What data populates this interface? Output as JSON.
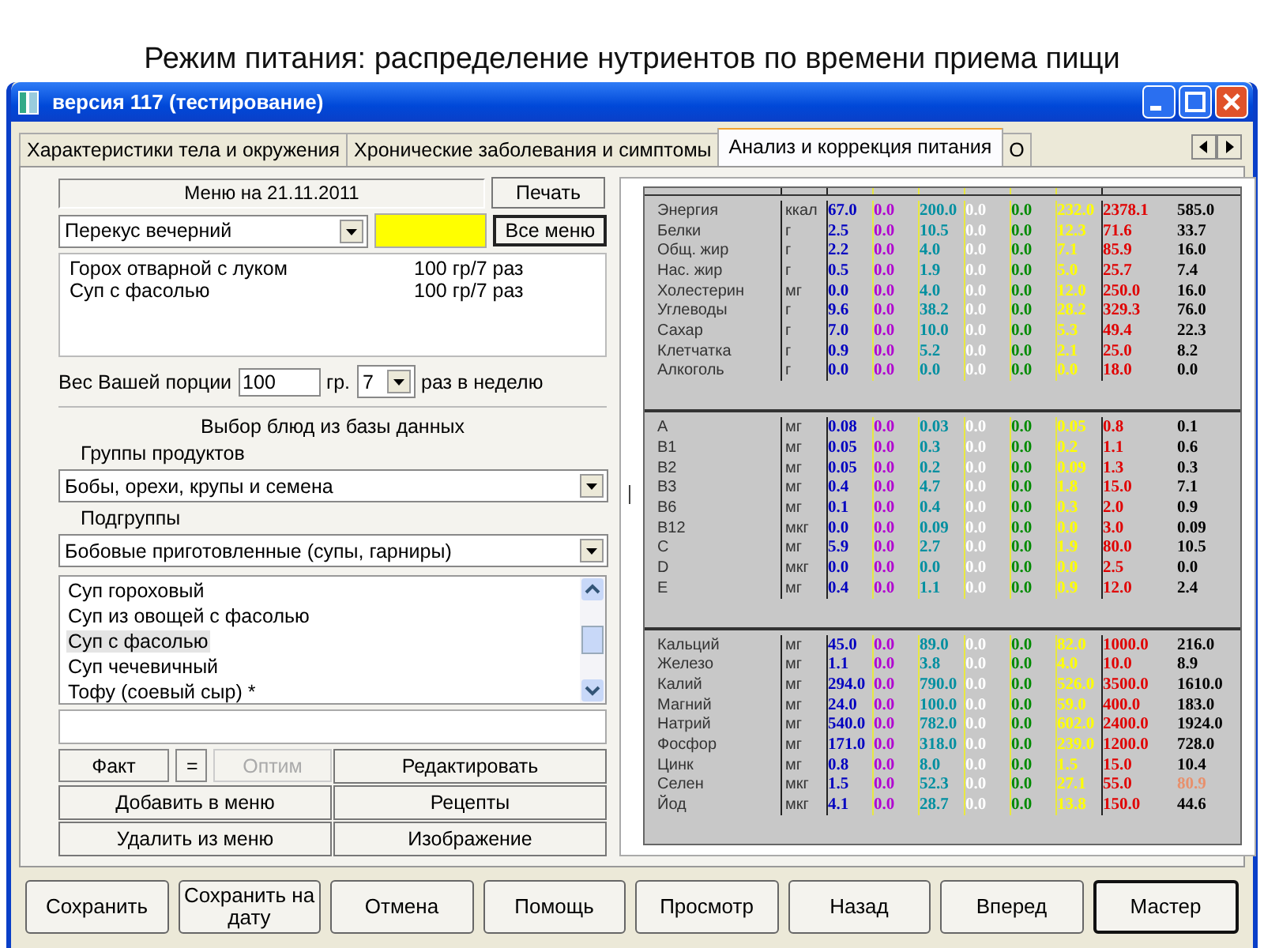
{
  "heading": "Режим питания: распределение нутриентов по времени приема пищи",
  "window": {
    "title": "версия 117 (тестирование)"
  },
  "tabs": [
    {
      "label": "Характеристики тела и окружения",
      "selected": false
    },
    {
      "label": "Хронические заболевания и симптомы",
      "selected": false
    },
    {
      "label": "Анализ и коррекция питания",
      "selected": true
    },
    {
      "label": "О",
      "selected": false
    }
  ],
  "menu": {
    "title": "Меню на 21.11.2011",
    "print_button": "Печать",
    "meal": "Перекус вечерний",
    "all_menu_button": "Все меню",
    "items": [
      {
        "name": "Горох отварной с луком",
        "portion": "100 гр/7 раз"
      },
      {
        "name": "Суп с фасолью",
        "portion": "100 гр/7 раз"
      }
    ]
  },
  "portion": {
    "label": "Вес Вашей порции",
    "value": "100",
    "unit": "гр.",
    "times": "7",
    "suffix": "раз в неделю"
  },
  "database": {
    "title": "Выбор блюд из базы данных",
    "groups_label": "Группы продуктов",
    "group": "Бобы, орехи, крупы и семена",
    "subgroups_label": "Подгруппы",
    "subgroup": "Бобовые приготовленные (супы, гарниры)",
    "dishes": [
      {
        "name": "Суп гороховый",
        "selected": false
      },
      {
        "name": "Суп из овощей с фасолью",
        "selected": false
      },
      {
        "name": "Суп с фасолью",
        "selected": true
      },
      {
        "name": "Суп чечевичный",
        "selected": false
      },
      {
        "name": "Тофу (соевый сыр) *",
        "selected": false
      }
    ]
  },
  "mode_buttons": [
    {
      "label": "Факт",
      "disabled": false
    },
    {
      "label": "=",
      "disabled": false
    },
    {
      "label": "Оптим",
      "disabled": true
    }
  ],
  "action_buttons": [
    "Редактировать",
    "Добавить в меню",
    "Рецепты",
    "Удалить из меню",
    "Изображение"
  ],
  "nutrients": {
    "columns": [
      {
        "color": "#0000c0"
      },
      {
        "color": "#b000d0"
      },
      {
        "color": "#008fa0"
      },
      {
        "color": "#ffffff"
      },
      {
        "color": "#008a00"
      },
      {
        "color": "#ffff00"
      },
      {
        "color": "#e00000"
      },
      {
        "color": "#000000"
      }
    ],
    "sections": [
      {
        "rows": [
          {
            "name": "Энергия",
            "unit": "ккал",
            "flagged": false,
            "values": [
              "67.0",
              "0.0",
              "200.0",
              "0.0",
              "0.0",
              "232.0",
              "2378.1",
              "585.0"
            ]
          },
          {
            "name": "Белки",
            "unit": "г",
            "flagged": false,
            "values": [
              "2.5",
              "0.0",
              "10.5",
              "0.0",
              "0.0",
              "12.3",
              "71.6",
              "33.7"
            ]
          },
          {
            "name": "Общ. жир",
            "unit": "г",
            "flagged": false,
            "values": [
              "2.2",
              "0.0",
              "4.0",
              "0.0",
              "0.0",
              "7.1",
              "85.9",
              "16.0"
            ]
          },
          {
            "name": "Нас. жир",
            "unit": "г",
            "flagged": false,
            "values": [
              "0.5",
              "0.0",
              "1.9",
              "0.0",
              "0.0",
              "5.0",
              "25.7",
              "7.4"
            ]
          },
          {
            "name": "Холестерин",
            "unit": "мг",
            "flagged": false,
            "values": [
              "0.0",
              "0.0",
              "4.0",
              "0.0",
              "0.0",
              "12.0",
              "250.0",
              "16.0"
            ]
          },
          {
            "name": "Углеводы",
            "unit": "г",
            "flagged": false,
            "values": [
              "9.6",
              "0.0",
              "38.2",
              "0.0",
              "0.0",
              "28.2",
              "329.3",
              "76.0"
            ]
          },
          {
            "name": "Сахар",
            "unit": "г",
            "flagged": false,
            "values": [
              "7.0",
              "0.0",
              "10.0",
              "0.0",
              "0.0",
              "5.3",
              "49.4",
              "22.3"
            ]
          },
          {
            "name": "Клетчатка",
            "unit": "г",
            "flagged": false,
            "values": [
              "0.9",
              "0.0",
              "5.2",
              "0.0",
              "0.0",
              "2.1",
              "25.0",
              "8.2"
            ]
          },
          {
            "name": "Алкоголь",
            "unit": "г",
            "flagged": false,
            "values": [
              "0.0",
              "0.0",
              "0.0",
              "0.0",
              "0.0",
              "0.0",
              "18.0",
              "0.0"
            ]
          }
        ]
      },
      {
        "rows": [
          {
            "name": "A",
            "unit": "мг",
            "flagged": false,
            "values": [
              "0.08",
              "0.0",
              "0.03",
              "0.0",
              "0.0",
              "0.05",
              "0.8",
              "0.1"
            ]
          },
          {
            "name": "B1",
            "unit": "мг",
            "flagged": false,
            "values": [
              "0.05",
              "0.0",
              "0.3",
              "0.0",
              "0.0",
              "0.2",
              "1.1",
              "0.6"
            ]
          },
          {
            "name": "B2",
            "unit": "мг",
            "flagged": false,
            "values": [
              "0.05",
              "0.0",
              "0.2",
              "0.0",
              "0.0",
              "0.09",
              "1.3",
              "0.3"
            ]
          },
          {
            "name": "B3",
            "unit": "мг",
            "flagged": false,
            "values": [
              "0.4",
              "0.0",
              "4.7",
              "0.0",
              "0.0",
              "1.8",
              "15.0",
              "7.1"
            ]
          },
          {
            "name": "B6",
            "unit": "мг",
            "flagged": false,
            "values": [
              "0.1",
              "0.0",
              "0.4",
              "0.0",
              "0.0",
              "0.3",
              "2.0",
              "0.9"
            ]
          },
          {
            "name": "B12",
            "unit": "мкг",
            "flagged": false,
            "values": [
              "0.0",
              "0.0",
              "0.09",
              "0.0",
              "0.0",
              "0.0",
              "3.0",
              "0.09"
            ]
          },
          {
            "name": "C",
            "unit": "мг",
            "flagged": false,
            "values": [
              "5.9",
              "0.0",
              "2.7",
              "0.0",
              "0.0",
              "1.9",
              "80.0",
              "10.5"
            ]
          },
          {
            "name": "D",
            "unit": "мкг",
            "flagged": false,
            "values": [
              "0.0",
              "0.0",
              "0.0",
              "0.0",
              "0.0",
              "0.0",
              "2.5",
              "0.0"
            ]
          },
          {
            "name": "E",
            "unit": "мг",
            "flagged": false,
            "values": [
              "0.4",
              "0.0",
              "1.1",
              "0.0",
              "0.0",
              "0.9",
              "12.0",
              "2.4"
            ]
          }
        ]
      },
      {
        "rows": [
          {
            "name": "Кальций",
            "unit": "мг",
            "flagged": false,
            "values": [
              "45.0",
              "0.0",
              "89.0",
              "0.0",
              "0.0",
              "82.0",
              "1000.0",
              "216.0"
            ]
          },
          {
            "name": "Железо",
            "unit": "мг",
            "flagged": false,
            "values": [
              "1.1",
              "0.0",
              "3.8",
              "0.0",
              "0.0",
              "4.0",
              "10.0",
              "8.9"
            ]
          },
          {
            "name": "Калий",
            "unit": "мг",
            "flagged": false,
            "values": [
              "294.0",
              "0.0",
              "790.0",
              "0.0",
              "0.0",
              "526.0",
              "3500.0",
              "1610.0"
            ]
          },
          {
            "name": "Магний",
            "unit": "мг",
            "flagged": false,
            "values": [
              "24.0",
              "0.0",
              "100.0",
              "0.0",
              "0.0",
              "59.0",
              "400.0",
              "183.0"
            ]
          },
          {
            "name": "Натрий",
            "unit": "мг",
            "flagged": false,
            "values": [
              "540.0",
              "0.0",
              "782.0",
              "0.0",
              "0.0",
              "602.0",
              "2400.0",
              "1924.0"
            ]
          },
          {
            "name": "Фосфор",
            "unit": "мг",
            "flagged": false,
            "values": [
              "171.0",
              "0.0",
              "318.0",
              "0.0",
              "0.0",
              "239.0",
              "1200.0",
              "728.0"
            ]
          },
          {
            "name": "Цинк",
            "unit": "мг",
            "flagged": false,
            "values": [
              "0.8",
              "0.0",
              "8.0",
              "0.0",
              "0.0",
              "1.5",
              "15.0",
              "10.4"
            ]
          },
          {
            "name": "Селен",
            "unit": "мкг",
            "flagged": true,
            "values": [
              "1.5",
              "0.0",
              "52.3",
              "0.0",
              "0.0",
              "27.1",
              "55.0",
              "80.9"
            ]
          },
          {
            "name": "Йод",
            "unit": "мкг",
            "flagged": false,
            "values": [
              "4.1",
              "0.0",
              "28.7",
              "0.0",
              "0.0",
              "13.8",
              "150.0",
              "44.6"
            ]
          }
        ]
      }
    ]
  },
  "bottom_buttons": [
    {
      "label": "Сохранить",
      "default": false
    },
    {
      "label": "Сохранить на дату",
      "default": false
    },
    {
      "label": "Отмена",
      "default": false
    },
    {
      "label": "Помощь",
      "default": false
    },
    {
      "label": "Просмотр",
      "default": false
    },
    {
      "label": "Назад",
      "default": false
    },
    {
      "label": "Вперед",
      "default": false
    },
    {
      "label": "Мастер",
      "default": true
    }
  ]
}
